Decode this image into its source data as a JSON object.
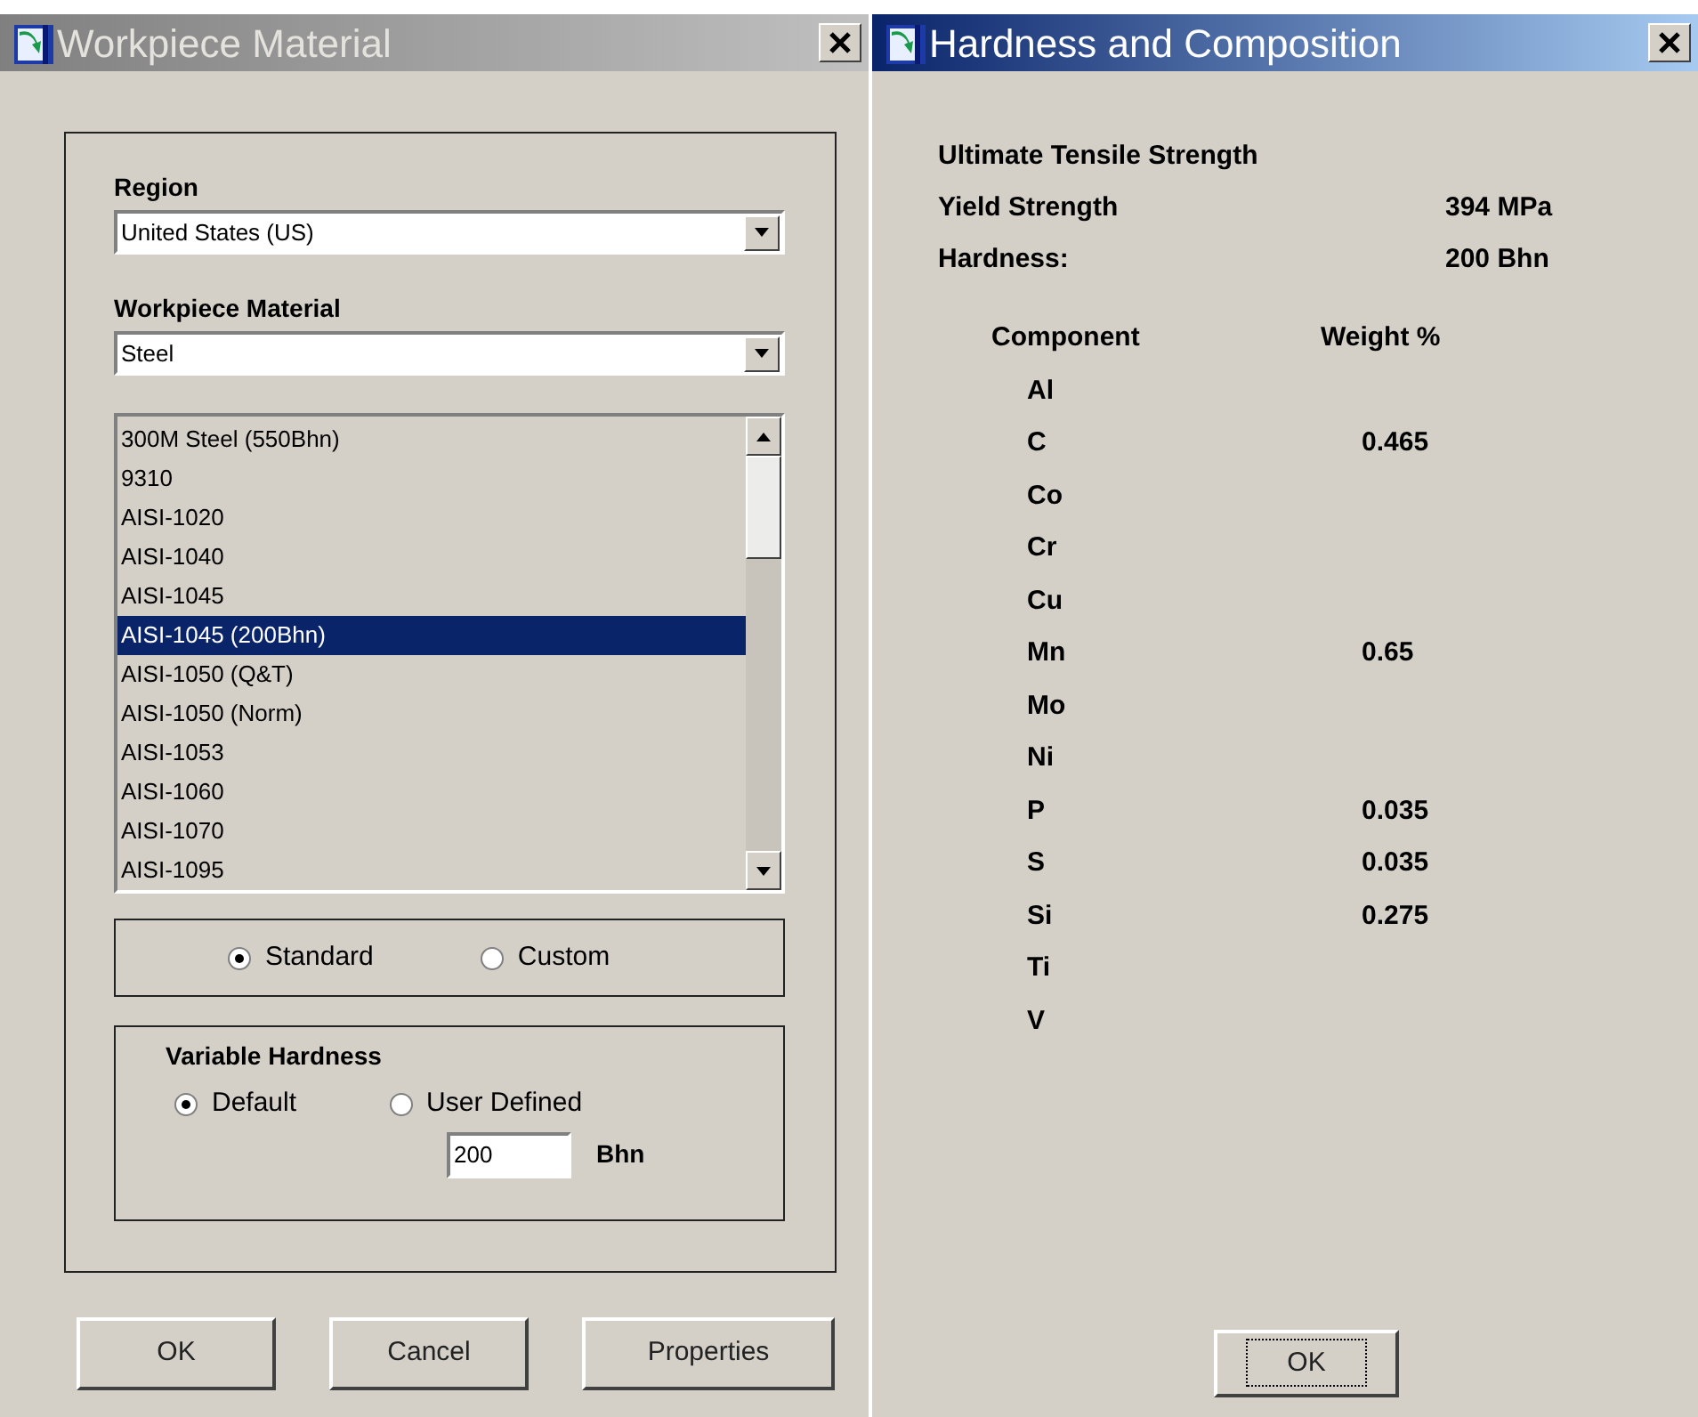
{
  "material_dialog": {
    "title": "Workpiece Material",
    "active": false,
    "region": {
      "label": "Region",
      "value": "United States (US)"
    },
    "material": {
      "label": "Workpiece Material",
      "value": "Steel"
    },
    "materials": [
      {
        "label": "300M Steel (550Bhn)",
        "selected": false
      },
      {
        "label": "9310",
        "selected": false
      },
      {
        "label": "AISI-1020",
        "selected": false
      },
      {
        "label": "AISI-1040",
        "selected": false
      },
      {
        "label": "AISI-1045",
        "selected": false
      },
      {
        "label": "AISI-1045 (200Bhn)",
        "selected": true
      },
      {
        "label": "AISI-1050 (Q&T)",
        "selected": false
      },
      {
        "label": "AISI-1050 (Norm)",
        "selected": false
      },
      {
        "label": "AISI-1053",
        "selected": false
      },
      {
        "label": "AISI-1060",
        "selected": false
      },
      {
        "label": "AISI-1070",
        "selected": false
      },
      {
        "label": "AISI-1095",
        "selected": false
      }
    ],
    "mode_options": [
      {
        "label": "Standard",
        "selected": true
      },
      {
        "label": "Custom",
        "selected": false
      }
    ],
    "variable_hardness": {
      "title": "Variable Hardness",
      "options": [
        {
          "label": "Default",
          "selected": true
        },
        {
          "label": "User Defined",
          "selected": false
        }
      ],
      "value": "200",
      "unit": "Bhn"
    },
    "buttons": [
      {
        "label": "OK",
        "focused": false
      },
      {
        "label": "Cancel",
        "focused": false
      },
      {
        "label": "Properties",
        "focused": false
      }
    ]
  },
  "composition_dialog": {
    "title": "Hardness and Composition",
    "active": true,
    "properties": [
      {
        "label": "Ultimate Tensile Strength"
      },
      {
        "label": "Yield Strength",
        "value": "394 MPa"
      },
      {
        "label": "Hardness:",
        "value": "200 Bhn"
      }
    ],
    "columns": [
      "Component",
      "Weight %"
    ],
    "components": [
      {
        "element": "Al"
      },
      {
        "element": "C",
        "weight": "0.465"
      },
      {
        "element": "Co"
      },
      {
        "element": "Cr"
      },
      {
        "element": "Cu"
      },
      {
        "element": "Mn",
        "weight": "0.65"
      },
      {
        "element": "Mo"
      },
      {
        "element": "Ni"
      },
      {
        "element": "P",
        "weight": "0.035"
      },
      {
        "element": "S",
        "weight": "0.035"
      },
      {
        "element": "Si",
        "weight": "0.275"
      },
      {
        "element": "Ti"
      },
      {
        "element": "V"
      }
    ],
    "buttons": [
      {
        "label": "OK",
        "focused": true
      }
    ]
  }
}
